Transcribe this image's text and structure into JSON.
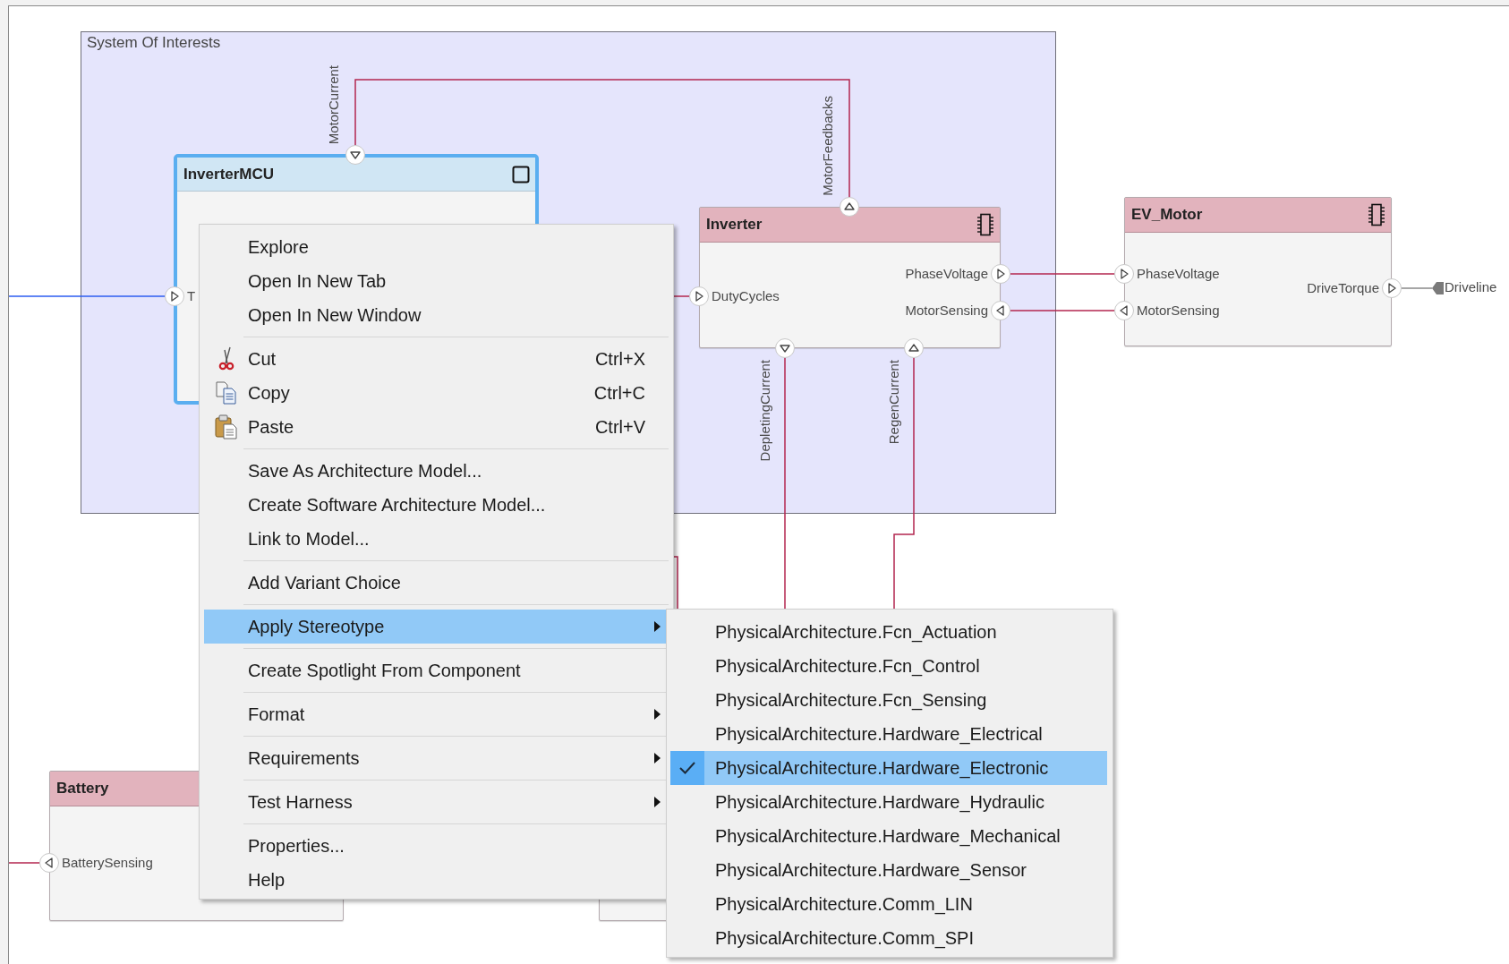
{
  "group": {
    "title": "System Of Interests"
  },
  "components": [
    {
      "name": "InverterMCU",
      "kind": "reference",
      "selected": true,
      "ports": [
        {
          "label": "MotorCurrent",
          "kind": "in"
        },
        {
          "label": "T",
          "kind": "in"
        }
      ]
    },
    {
      "name": "Inverter",
      "kind": "hardware",
      "selected": false,
      "ports": [
        {
          "label": "MotorFeedbacks",
          "kind": "out"
        },
        {
          "label": "DutyCycles",
          "kind": "in"
        },
        {
          "label": "PhaseVoltage",
          "kind": "out"
        },
        {
          "label": "MotorSensing",
          "kind": "in"
        },
        {
          "label": "DepletingCurrent",
          "kind": "out"
        },
        {
          "label": "RegenCurrent",
          "kind": "in"
        }
      ]
    },
    {
      "name": "EV_Motor",
      "kind": "hardware",
      "selected": false,
      "ports": [
        {
          "label": "PhaseVoltage",
          "kind": "in"
        },
        {
          "label": "MotorSensing",
          "kind": "out"
        },
        {
          "label": "DriveTorque",
          "kind": "out"
        }
      ]
    },
    {
      "name": "Battery",
      "selected": false,
      "ports": [
        {
          "label": "BatterySensing",
          "kind": "out"
        }
      ]
    },
    {
      "selected": false
    }
  ],
  "external_ports": [
    {
      "label": "Driveline"
    }
  ],
  "context_menu": {
    "groups": [
      [
        {
          "label": "Explore",
          "kind": "plain",
          "selected": false
        },
        {
          "label": "Open In New Tab",
          "kind": "plain",
          "selected": false
        },
        {
          "label": "Open In New Window",
          "kind": "plain",
          "selected": false
        }
      ],
      [
        {
          "label": "Cut",
          "kind": "cut",
          "shortcut": "Ctrl+X",
          "selected": false
        },
        {
          "label": "Copy",
          "kind": "copy",
          "shortcut": "Ctrl+C",
          "selected": false
        },
        {
          "label": "Paste",
          "kind": "paste",
          "shortcut": "Ctrl+V",
          "selected": false
        }
      ],
      [
        {
          "label": "Save As Architecture Model...",
          "kind": "plain",
          "selected": false
        },
        {
          "label": "Create Software Architecture Model...",
          "kind": "plain",
          "selected": false
        },
        {
          "label": "Link to Model...",
          "kind": "plain",
          "selected": false
        }
      ],
      [
        {
          "label": "Add Variant Choice",
          "kind": "plain",
          "selected": false
        }
      ],
      [
        {
          "label": "Apply Stereotype",
          "kind": "plain",
          "submenu": true,
          "selected": true
        }
      ],
      [
        {
          "label": "Create Spotlight From Component",
          "kind": "plain",
          "selected": false
        }
      ],
      [
        {
          "label": "Format",
          "kind": "plain",
          "submenu": true,
          "selected": false
        }
      ],
      [
        {
          "label": "Requirements",
          "kind": "plain",
          "submenu": true,
          "selected": false
        }
      ],
      [
        {
          "label": "Test Harness",
          "kind": "plain",
          "submenu": true,
          "selected": false
        }
      ],
      [
        {
          "label": "Properties...",
          "kind": "plain",
          "selected": false
        },
        {
          "label": "Help",
          "kind": "plain",
          "selected": false
        }
      ]
    ]
  },
  "stereotype_menu": {
    "items": [
      {
        "label": "PhysicalArchitecture.Fcn_Actuation",
        "checked": false,
        "selected": false
      },
      {
        "label": "PhysicalArchitecture.Fcn_Control",
        "checked": false,
        "selected": false
      },
      {
        "label": "PhysicalArchitecture.Fcn_Sensing",
        "checked": false,
        "selected": false
      },
      {
        "label": "PhysicalArchitecture.Hardware_Electrical",
        "checked": false,
        "selected": false
      },
      {
        "label": "PhysicalArchitecture.Hardware_Electronic",
        "checked": true,
        "selected": true
      },
      {
        "label": "PhysicalArchitecture.Hardware_Hydraulic",
        "checked": false,
        "selected": false
      },
      {
        "label": "PhysicalArchitecture.Hardware_Mechanical",
        "checked": false,
        "selected": false
      },
      {
        "label": "PhysicalArchitecture.Hardware_Sensor",
        "checked": false,
        "selected": false
      },
      {
        "label": "PhysicalArchitecture.Comm_LIN",
        "checked": false,
        "selected": false
      },
      {
        "label": "PhysicalArchitecture.Comm_SPI",
        "checked": false,
        "selected": false
      }
    ]
  }
}
